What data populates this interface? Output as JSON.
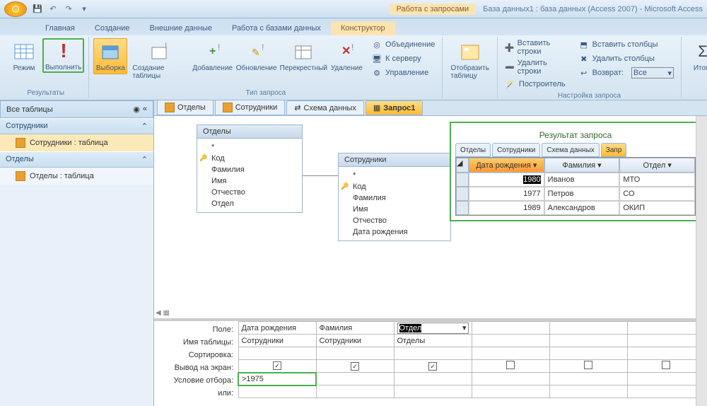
{
  "titlebar": {
    "context_label": "Работа с запросами",
    "app_title": "База данных1 : база данных (Access 2007) - Microsoft Access"
  },
  "ribbon_tabs": {
    "home": "Главная",
    "create": "Создание",
    "external": "Внешние данные",
    "dbtools": "Работа с базами данных",
    "designer": "Конструктор"
  },
  "ribbon": {
    "results": {
      "label": "Результаты",
      "mode": "Режим",
      "run": "Выполнить"
    },
    "querytype": {
      "label": "Тип запроса",
      "select": "Выборка",
      "maketable": "Создание таблицы",
      "append": "Добавление",
      "update": "Обновление",
      "crosstab": "Перекрестный",
      "delete": "Удаление",
      "union": "Объединение",
      "passthrough": "К серверу",
      "ddl": "Управление"
    },
    "showtable": {
      "btn": "Отобразить таблицу"
    },
    "setup": {
      "label": "Настройка запроса",
      "insert_rows": "Вставить строки",
      "delete_rows": "Удалить строки",
      "builder": "Построитель",
      "insert_cols": "Вставить столбцы",
      "delete_cols": "Удалить столбцы",
      "return_lbl": "Возврат:",
      "return_val": "Все"
    },
    "totals": "Итоги"
  },
  "nav": {
    "header": "Все таблицы",
    "group1": "Сотрудники",
    "item1": "Сотрудники : таблица",
    "group2": "Отделы",
    "item2": "Отделы : таблица"
  },
  "doc_tabs": {
    "t1": "Отделы",
    "t2": "Сотрудники",
    "t3": "Схема данных",
    "t4": "Запрос1"
  },
  "tablebox1": {
    "title": "Отделы",
    "star": "*",
    "f1": "Код",
    "f2": "Фамилия",
    "f3": "Имя",
    "f4": "Отчество",
    "f5": "Отдел"
  },
  "tablebox2": {
    "title": "Сотрудники",
    "star": "*",
    "f1": "Код",
    "f2": "Фамилия",
    "f3": "Имя",
    "f4": "Отчество",
    "f5": "Дата рождения"
  },
  "result": {
    "title": "Результат запроса",
    "tabs": {
      "t1": "Отделы",
      "t2": "Сотрудники",
      "t3": "Схема данных",
      "t4": "Запр"
    },
    "col1": "Дата рождения",
    "col2": "Фамилия",
    "col3": "Отдел",
    "rows": [
      {
        "c1": "1980",
        "c2": "Иванов",
        "c3": "МТО"
      },
      {
        "c1": "1977",
        "c2": "Петров",
        "c3": "СО"
      },
      {
        "c1": "1989",
        "c2": "Александров",
        "c3": "ОКИП"
      }
    ]
  },
  "qgrid": {
    "labels": {
      "field": "Поле:",
      "table": "Имя таблицы:",
      "sort": "Сортировка:",
      "show": "Вывод на экран:",
      "criteria": "Условие отбора:",
      "or": "или:"
    },
    "c1": {
      "field": "Дата рождения",
      "table": "Сотрудники",
      "criteria": ">1975"
    },
    "c2": {
      "field": "Фамилия",
      "table": "Сотрудники"
    },
    "c3": {
      "field": "Отдел",
      "table": "Отделы"
    }
  }
}
